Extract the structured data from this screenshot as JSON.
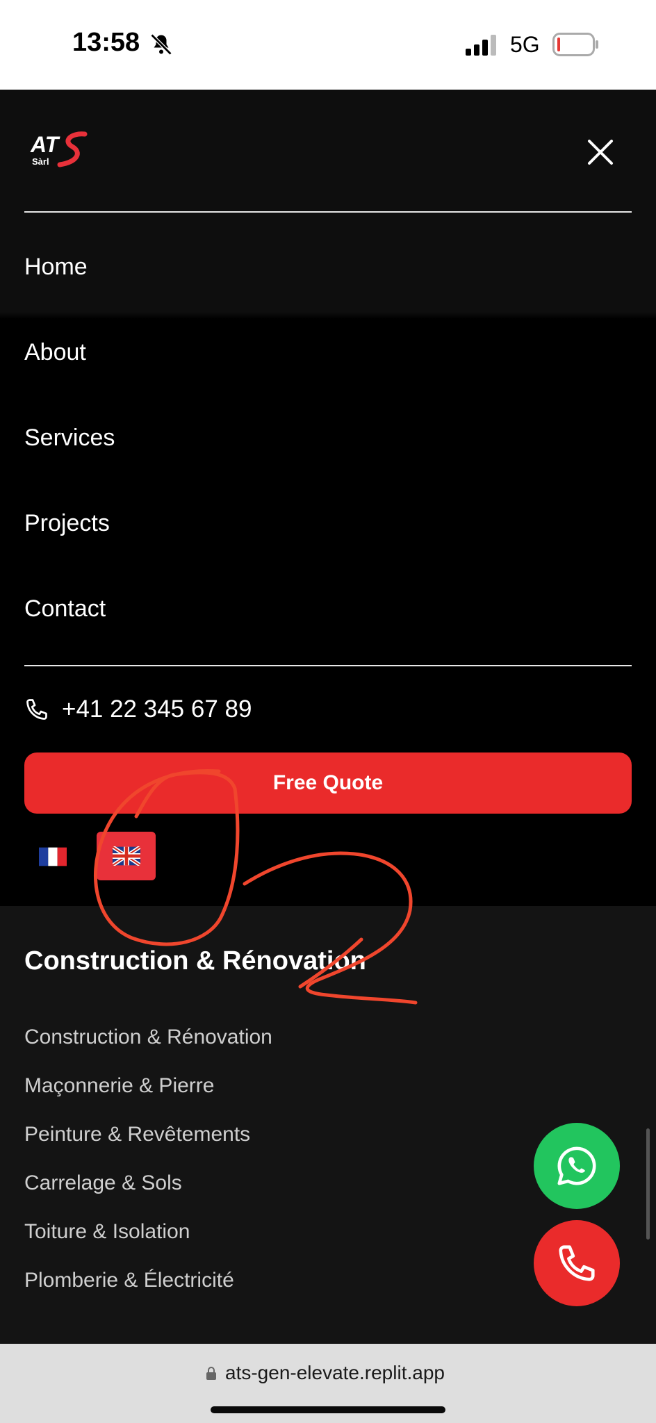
{
  "status_bar": {
    "time": "13:58",
    "network": "5G"
  },
  "menu": {
    "logo_text": "ATS",
    "logo_sub": "Sàrl",
    "nav_items": [
      {
        "label": "Home"
      },
      {
        "label": "About"
      },
      {
        "label": "Services"
      },
      {
        "label": "Projects"
      },
      {
        "label": "Contact"
      }
    ],
    "phone": "+41 22 345 67 89",
    "quote_label": "Free Quote",
    "languages": [
      {
        "flag": "🇫🇷",
        "code": "fr",
        "active": false
      },
      {
        "flag": "🇬🇧",
        "code": "en",
        "active": true
      }
    ]
  },
  "footer": {
    "title": "Construction & Rénovation",
    "services": [
      "Construction & Rénovation",
      "Maçonnerie & Pierre",
      "Peinture & Revêtements",
      "Carrelage & Sols",
      "Toiture & Isolation",
      "Plomberie & Électricité"
    ]
  },
  "browser": {
    "url": "ats-gen-elevate.replit.app"
  },
  "colors": {
    "accent_red": "#ea2b2b",
    "whatsapp_green": "#22c55e",
    "annotation_red": "#f0462d"
  },
  "annotation": {
    "number_drawn": "2"
  }
}
